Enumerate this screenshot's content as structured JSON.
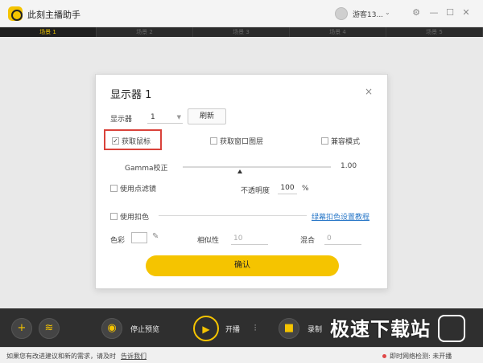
{
  "app": {
    "title": "此刻主播助手",
    "user": "游客13..."
  },
  "window_controls": {
    "settings": "⚙",
    "minimize": "—",
    "maximize": "☐",
    "close": "✕"
  },
  "scenes": [
    "场景 1",
    "场景 2",
    "场景 3",
    "场景 4",
    "场景 5"
  ],
  "active_scene": 0,
  "dialog": {
    "title": "显示器 1",
    "close": "×",
    "display_label": "显示器",
    "display_value": "1",
    "refresh_label": "刷新",
    "capture_mouse": {
      "label": "获取鼠标",
      "checked": true
    },
    "capture_window_layer": {
      "label": "获取窗口图层",
      "checked": false
    },
    "compat_mode": {
      "label": "兼容模式",
      "checked": false
    },
    "gamma": {
      "label": "Gamma校正",
      "value": "1.00"
    },
    "point_filter": {
      "label": "使用点滤镜",
      "checked": false
    },
    "opacity": {
      "label": "不透明度",
      "value": "100",
      "unit": "%"
    },
    "chroma_key": {
      "label": "使用扣色",
      "checked": false
    },
    "chroma_tutorial_link": "绿幕扣色设置教程",
    "color_label": "色彩",
    "similarity": {
      "label": "相似性",
      "value": "10"
    },
    "blend": {
      "label": "混合",
      "value": "0"
    },
    "confirm_label": "确认"
  },
  "toolbar": {
    "add_icon": "+",
    "stop_preview_label": "停止预览",
    "live_label": "开播",
    "record_label": "录制"
  },
  "watermark": "极速下载站",
  "status": {
    "feedback_text": "如果您有改进建议和新的需求，请及时",
    "feedback_link": "告诉我们",
    "network_text": "即时网络检测: 未开播"
  }
}
